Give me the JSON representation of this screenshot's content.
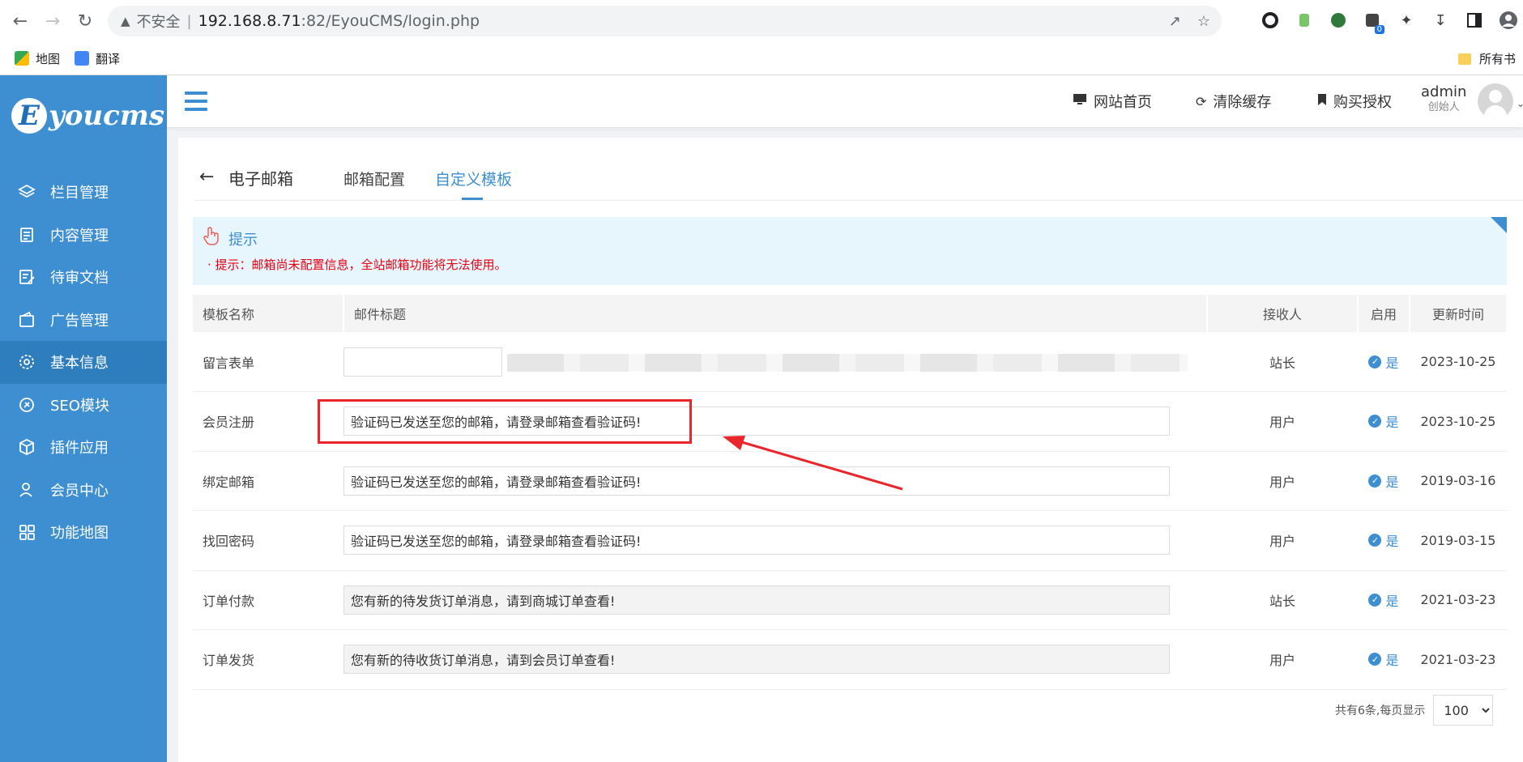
{
  "browser": {
    "insecure_label": "不安全",
    "url_host": "192.168.8.71",
    "url_path": ":82/EyouCMS/login.php",
    "ext_badge": "0",
    "bookmarks": [
      {
        "label": "地图"
      },
      {
        "label": "翻译"
      }
    ],
    "bookmarks_right": "所有书"
  },
  "sidebar": {
    "logo_letter": "E",
    "logo_text": "youcms",
    "items": [
      {
        "label": "栏目管理",
        "icon": "layers-icon"
      },
      {
        "label": "内容管理",
        "icon": "document-icon"
      },
      {
        "label": "待审文档",
        "icon": "edit-document-icon"
      },
      {
        "label": "广告管理",
        "icon": "ad-icon"
      },
      {
        "label": "基本信息",
        "icon": "gear-icon",
        "active": true
      },
      {
        "label": "SEO模块",
        "icon": "seo-icon"
      },
      {
        "label": "插件应用",
        "icon": "cube-icon"
      },
      {
        "label": "会员中心",
        "icon": "user-icon"
      },
      {
        "label": "功能地图",
        "icon": "grid-icon"
      }
    ]
  },
  "header": {
    "site_home": "网站首页",
    "clear_cache": "清除缓存",
    "buy_license": "购买授权",
    "user_name": "admin",
    "user_role": "创始人"
  },
  "tabs": {
    "title": "电子邮箱",
    "items": [
      {
        "label": "邮箱配置",
        "active": false
      },
      {
        "label": "自定义模板",
        "active": true
      }
    ]
  },
  "tip": {
    "title": "提示",
    "message": "· 提示：邮箱尚未配置信息，全站邮箱功能将无法使用。"
  },
  "table": {
    "headers": [
      "模板名称",
      "邮件标题",
      "接收人",
      "启用",
      "更新时间"
    ],
    "rows": [
      {
        "name": "留言表单",
        "subject": "",
        "receiver": "站长",
        "enabled": "是",
        "updated": "2023-10-25"
      },
      {
        "name": "会员注册",
        "subject": "验证码已发送至您的邮箱，请登录邮箱查看验证码!",
        "receiver": "用户",
        "enabled": "是",
        "updated": "2023-10-25"
      },
      {
        "name": "绑定邮箱",
        "subject": "验证码已发送至您的邮箱，请登录邮箱查看验证码!",
        "receiver": "用户",
        "enabled": "是",
        "updated": "2019-03-16"
      },
      {
        "name": "找回密码",
        "subject": "验证码已发送至您的邮箱，请登录邮箱查看验证码!",
        "receiver": "用户",
        "enabled": "是",
        "updated": "2019-03-15"
      },
      {
        "name": "订单付款",
        "subject": "您有新的待发货订单消息，请到商城订单查看!",
        "receiver": "站长",
        "enabled": "是",
        "updated": "2021-03-23"
      },
      {
        "name": "订单发货",
        "subject": "您有新的待收货订单消息，请到会员订单查看!",
        "receiver": "用户",
        "enabled": "是",
        "updated": "2021-03-23"
      }
    ]
  },
  "pager": {
    "summary": "共有6条,每页显示",
    "page_size": "100"
  },
  "colors": {
    "sidebar": "#3d8fd2",
    "sidebar_active": "#2e7dbd",
    "accent": "#3d8fd2",
    "warning": "#e60012",
    "annotation": "#e8262b"
  }
}
